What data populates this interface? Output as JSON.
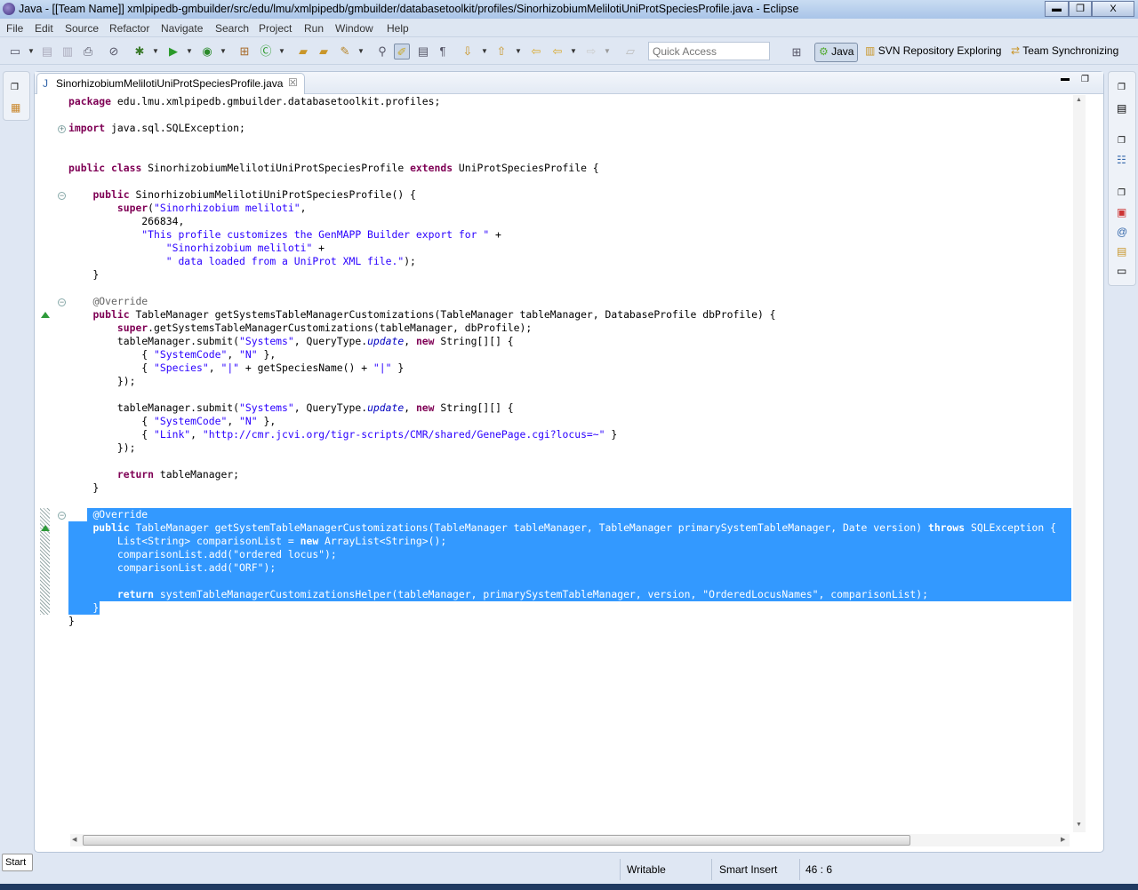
{
  "window": {
    "title": "Java - [[Team Name]] xmlpipedb-gmbuilder/src/edu/lmu/xmlpipedb/gmbuilder/databasetoolkit/profiles/SinorhizobiumMelilotiUniProtSpeciesProfile.java - Eclipse",
    "minimize": "▬",
    "restore": "❐",
    "close": "X"
  },
  "menu": [
    "File",
    "Edit",
    "Source",
    "Refactor",
    "Navigate",
    "Search",
    "Project",
    "Run",
    "Window",
    "Help"
  ],
  "toolbar": {
    "quick_access_placeholder": "Quick Access"
  },
  "perspectives": {
    "java": "Java",
    "svn": "SVN Repository Exploring",
    "team": "Team Synchronizing"
  },
  "editor": {
    "tab_label": "SinorhizobiumMelilotiUniProtSpeciesProfile.java",
    "selection_color": "#3399ff",
    "lines": [
      [
        [
          "k",
          "package"
        ],
        [
          "p",
          " edu.lmu.xmlpipedb.gmbuilder.databasetoolkit.profiles;"
        ]
      ],
      [],
      [
        [
          "k",
          "import"
        ],
        [
          "p",
          " java.sql.SQLException;"
        ]
      ],
      [],
      [],
      [
        [
          "k",
          "public"
        ],
        [
          "p",
          " "
        ],
        [
          "k",
          "class"
        ],
        [
          "p",
          " SinorhizobiumMelilotiUniProtSpeciesProfile "
        ],
        [
          "k",
          "extends"
        ],
        [
          "p",
          " UniProtSpeciesProfile {"
        ]
      ],
      [],
      [
        [
          "p",
          "    "
        ],
        [
          "k",
          "public"
        ],
        [
          "p",
          " SinorhizobiumMelilotiUniProtSpeciesProfile() {"
        ]
      ],
      [
        [
          "p",
          "        "
        ],
        [
          "k",
          "super"
        ],
        [
          "p",
          "("
        ],
        [
          "s",
          "\"Sinorhizobium meliloti\""
        ],
        [
          "p",
          ","
        ]
      ],
      [
        [
          "p",
          "            266834,"
        ]
      ],
      [
        [
          "p",
          "            "
        ],
        [
          "s",
          "\"This profile customizes the GenMAPP Builder export for \""
        ],
        [
          "p",
          " +"
        ]
      ],
      [
        [
          "p",
          "                "
        ],
        [
          "s",
          "\"Sinorhizobium meliloti\""
        ],
        [
          "p",
          " +"
        ]
      ],
      [
        [
          "p",
          "                "
        ],
        [
          "s",
          "\" data loaded from a UniProt XML file.\""
        ],
        [
          "p",
          ");"
        ]
      ],
      [
        [
          "p",
          "    }"
        ]
      ],
      [],
      [
        [
          "p",
          "    "
        ],
        [
          "a",
          "@Override"
        ]
      ],
      [
        [
          "p",
          "    "
        ],
        [
          "k",
          "public"
        ],
        [
          "p",
          " TableManager getSystemsTableManagerCustomizations(TableManager tableManager, DatabaseProfile dbProfile) {"
        ]
      ],
      [
        [
          "p",
          "        "
        ],
        [
          "k",
          "super"
        ],
        [
          "p",
          ".getSystemsTableManagerCustomizations(tableManager, dbProfile);"
        ]
      ],
      [
        [
          "p",
          "        tableManager.submit("
        ],
        [
          "s",
          "\"Systems\""
        ],
        [
          "p",
          ", QueryType."
        ],
        [
          "i",
          "update"
        ],
        [
          "p",
          ", "
        ],
        [
          "k",
          "new"
        ],
        [
          "p",
          " String[][] {"
        ]
      ],
      [
        [
          "p",
          "            { "
        ],
        [
          "s",
          "\"SystemCode\""
        ],
        [
          "p",
          ", "
        ],
        [
          "s",
          "\"N\""
        ],
        [
          "p",
          " },"
        ]
      ],
      [
        [
          "p",
          "            { "
        ],
        [
          "s",
          "\"Species\""
        ],
        [
          "p",
          ", "
        ],
        [
          "s",
          "\"|\""
        ],
        [
          "p",
          " + getSpeciesName() + "
        ],
        [
          "s",
          "\"|\""
        ],
        [
          "p",
          " }"
        ]
      ],
      [
        [
          "p",
          "        });"
        ]
      ],
      [],
      [
        [
          "p",
          "        tableManager.submit("
        ],
        [
          "s",
          "\"Systems\""
        ],
        [
          "p",
          ", QueryType."
        ],
        [
          "i",
          "update"
        ],
        [
          "p",
          ", "
        ],
        [
          "k",
          "new"
        ],
        [
          "p",
          " String[][] {"
        ]
      ],
      [
        [
          "p",
          "            { "
        ],
        [
          "s",
          "\"SystemCode\""
        ],
        [
          "p",
          ", "
        ],
        [
          "s",
          "\"N\""
        ],
        [
          "p",
          " },"
        ]
      ],
      [
        [
          "p",
          "            { "
        ],
        [
          "s",
          "\"Link\""
        ],
        [
          "p",
          ", "
        ],
        [
          "s",
          "\"http://cmr.jcvi.org/tigr-scripts/CMR/shared/GenePage.cgi?locus=~\""
        ],
        [
          "p",
          " }"
        ]
      ],
      [
        [
          "p",
          "        });"
        ]
      ],
      [],
      [
        [
          "p",
          "        "
        ],
        [
          "k",
          "return"
        ],
        [
          "p",
          " tableManager;"
        ]
      ],
      [
        [
          "p",
          "    }"
        ]
      ],
      [],
      [
        [
          "p",
          "    "
        ],
        [
          "a",
          "@Override"
        ]
      ],
      [
        [
          "p",
          "    "
        ],
        [
          "k",
          "public"
        ],
        [
          "p",
          " TableManager getSystemTableManagerCustomizations(TableManager tableManager, TableManager primarySystemTableManager, Date version) "
        ],
        [
          "k",
          "throws"
        ],
        [
          "p",
          " SQLException {"
        ]
      ],
      [
        [
          "p",
          "        List<String> comparisonList = "
        ],
        [
          "k",
          "new"
        ],
        [
          "p",
          " ArrayList<String>();"
        ]
      ],
      [
        [
          "p",
          "        comparisonList.add("
        ],
        [
          "s",
          "\"ordered locus\""
        ],
        [
          "p",
          ");"
        ]
      ],
      [
        [
          "p",
          "        comparisonList.add("
        ],
        [
          "s",
          "\"ORF\""
        ],
        [
          "p",
          ");"
        ]
      ],
      [],
      [
        [
          "p",
          "        "
        ],
        [
          "k",
          "return"
        ],
        [
          "p",
          " systemTableManagerCustomizationsHelper(tableManager, primarySystemTableManager, version, "
        ],
        [
          "s",
          "\"OrderedLocusNames\""
        ],
        [
          "p",
          ", comparisonList);"
        ]
      ],
      [
        [
          "p",
          "    }"
        ]
      ],
      [
        [
          "p",
          "}"
        ]
      ]
    ]
  },
  "status": {
    "writable": "Writable",
    "insert_mode": "Smart Insert",
    "position": "46 : 6"
  },
  "start_label": "Start"
}
